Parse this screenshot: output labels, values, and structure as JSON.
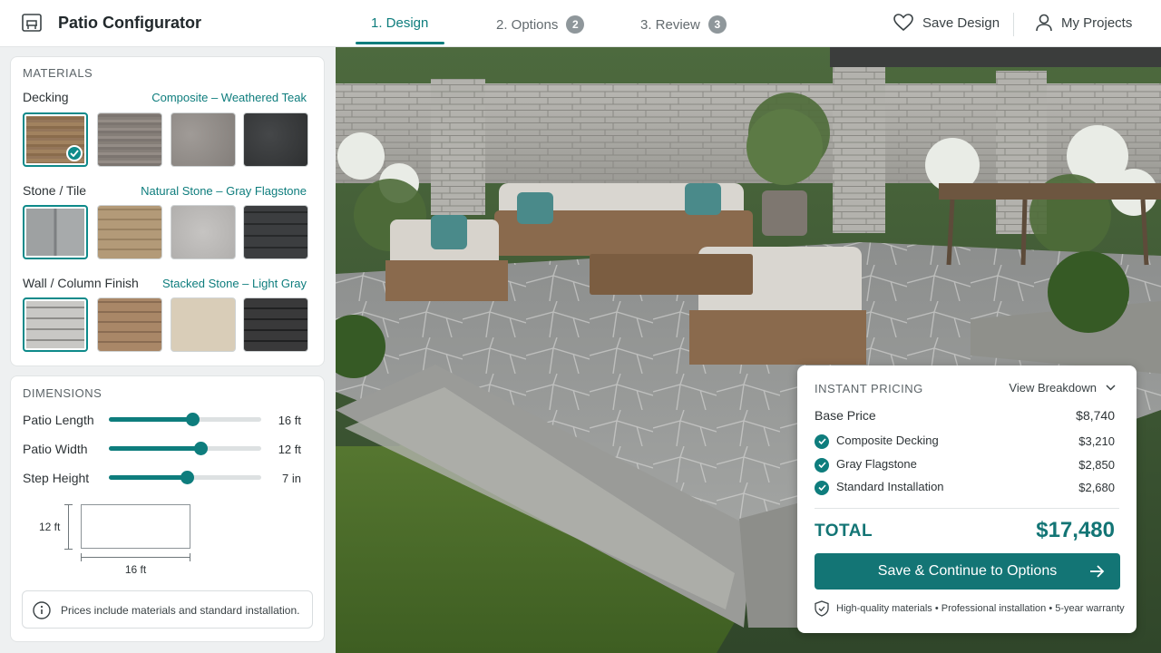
{
  "header": {
    "app_title": "Patio Configurator",
    "steps": [
      {
        "label": "1. Design",
        "badge": "",
        "active": true
      },
      {
        "label": "2. Options",
        "badge": "2",
        "active": false
      },
      {
        "label": "3. Review",
        "badge": "3",
        "active": false
      }
    ],
    "save_design": "Save Design",
    "my_projects": "My Projects"
  },
  "materials": {
    "title": "MATERIALS",
    "groups": [
      {
        "label": "Decking",
        "selected": "Composite – Weathered Teak",
        "selected_index": 0
      },
      {
        "label": "Stone / Tile",
        "selected": "Natural Stone – Gray Flagstone",
        "selected_index": 0
      },
      {
        "label": "Wall / Column Finish",
        "selected": "Stacked Stone – Light Gray",
        "selected_index": 0
      }
    ]
  },
  "dimensions": {
    "title": "DIMENSIONS",
    "sliders": [
      {
        "label": "Patio Length",
        "value": "16 ft",
        "fraction": 0.55
      },
      {
        "label": "Patio Width",
        "value": "12 ft",
        "fraction": 0.6
      },
      {
        "label": "Step Height",
        "value": "7 in",
        "fraction": 0.51
      }
    ],
    "diagram_height": "12 ft",
    "diagram_width": "16 ft",
    "note": "Prices include materials and standard installation."
  },
  "pricing": {
    "title": "INSTANT PRICING",
    "view_breakdown": "View Breakdown",
    "base_label": "Base Price",
    "base_value": "$8,740",
    "items": [
      {
        "label": "Composite Decking",
        "value": "$3,210"
      },
      {
        "label": "Gray Flagstone",
        "value": "$2,850"
      },
      {
        "label": "Standard Installation",
        "value": "$2,680"
      }
    ],
    "total_label": "TOTAL",
    "total_value": "$17,480",
    "cta": "Save & Continue to Options",
    "footer": "High-quality materials • Professional installation • 5-year warranty"
  },
  "colors": {
    "accent": "#0e7d7d",
    "cta": "#137575"
  }
}
